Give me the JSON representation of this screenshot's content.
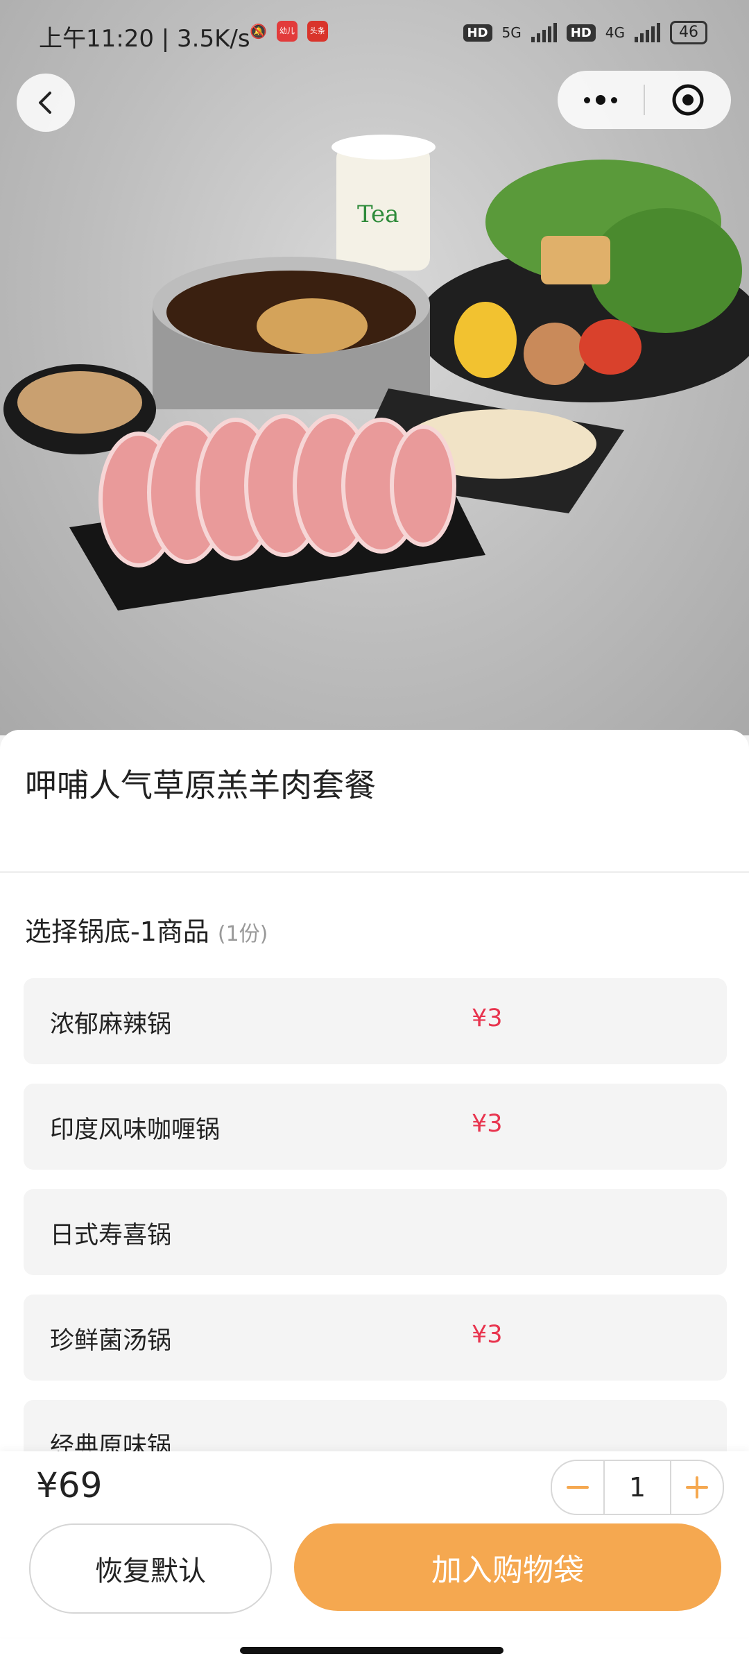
{
  "status_bar": {
    "time": "上午11:20 | 3.5K/s",
    "badges": [
      "幼儿",
      "头条"
    ],
    "network_5g": "5G",
    "network_4g": "4G",
    "hd": "HD",
    "battery": "46"
  },
  "nav": {
    "back_icon": "chevron-left-icon",
    "more_icon": "more-dots-icon",
    "close_icon": "target-close-icon"
  },
  "product": {
    "title": "呷哺人气草原羔羊肉套餐",
    "image_label": "hotpot-set-photo"
  },
  "section": {
    "title": "选择锅底-1商品",
    "count": "(1份)"
  },
  "options": [
    {
      "name": "浓郁麻辣锅",
      "price": "¥3"
    },
    {
      "name": "印度风味咖喱锅",
      "price": "¥3"
    },
    {
      "name": "日式寿喜锅",
      "price": ""
    },
    {
      "name": "珍鲜菌汤锅",
      "price": "¥3"
    },
    {
      "name": "经典原味锅",
      "price": ""
    }
  ],
  "footer": {
    "total": "¥69",
    "quantity": "1",
    "reset_label": "恢复默认",
    "add_label": "加入购物袋"
  },
  "colors": {
    "accent": "#f5a850",
    "price_red": "#e8344e"
  }
}
